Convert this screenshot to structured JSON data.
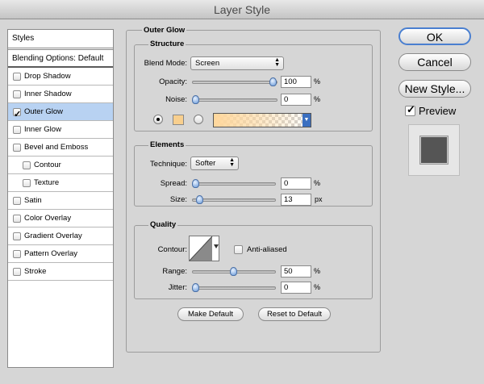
{
  "window": {
    "title": "Layer Style"
  },
  "sidebar": {
    "header": "Styles",
    "blending": "Blending Options: Default",
    "items": [
      {
        "label": "Drop Shadow",
        "checked": false,
        "indent": false
      },
      {
        "label": "Inner Shadow",
        "checked": false,
        "indent": false
      },
      {
        "label": "Outer Glow",
        "checked": true,
        "indent": false,
        "selected": true
      },
      {
        "label": "Inner Glow",
        "checked": false,
        "indent": false
      },
      {
        "label": "Bevel and Emboss",
        "checked": false,
        "indent": false
      },
      {
        "label": "Contour",
        "checked": false,
        "indent": true
      },
      {
        "label": "Texture",
        "checked": false,
        "indent": true
      },
      {
        "label": "Satin",
        "checked": false,
        "indent": false
      },
      {
        "label": "Color Overlay",
        "checked": false,
        "indent": false
      },
      {
        "label": "Gradient Overlay",
        "checked": false,
        "indent": false
      },
      {
        "label": "Pattern Overlay",
        "checked": false,
        "indent": false
      },
      {
        "label": "Stroke",
        "checked": false,
        "indent": false
      }
    ]
  },
  "panel": {
    "title": "Outer Glow",
    "structure": {
      "title": "Structure",
      "blend_mode_label": "Blend Mode:",
      "blend_mode_value": "Screen",
      "opacity_label": "Opacity:",
      "opacity_value": "100",
      "opacity_level": 1.0,
      "noise_label": "Noise:",
      "noise_value": "0",
      "noise_level": 0,
      "percent": "%",
      "swatch_color": "#f8cf8e",
      "gradient_color": "#ffd79c"
    },
    "elements": {
      "title": "Elements",
      "technique_label": "Technique:",
      "technique_value": "Softer",
      "spread_label": "Spread:",
      "spread_value": "0",
      "spread_level": 0,
      "size_label": "Size:",
      "size_value": "13",
      "size_level": 0.05,
      "percent": "%",
      "px": "px"
    },
    "quality": {
      "title": "Quality",
      "contour_label": "Contour:",
      "antialiased_label": "Anti-aliased",
      "range_label": "Range:",
      "range_value": "50",
      "range_level": 0.5,
      "jitter_label": "Jitter:",
      "jitter_value": "0",
      "jitter_level": 0,
      "percent": "%"
    },
    "make_default": "Make Default",
    "reset_default": "Reset to Default"
  },
  "actions": {
    "ok": "OK",
    "cancel": "Cancel",
    "new_style": "New Style...",
    "preview": "Preview"
  }
}
